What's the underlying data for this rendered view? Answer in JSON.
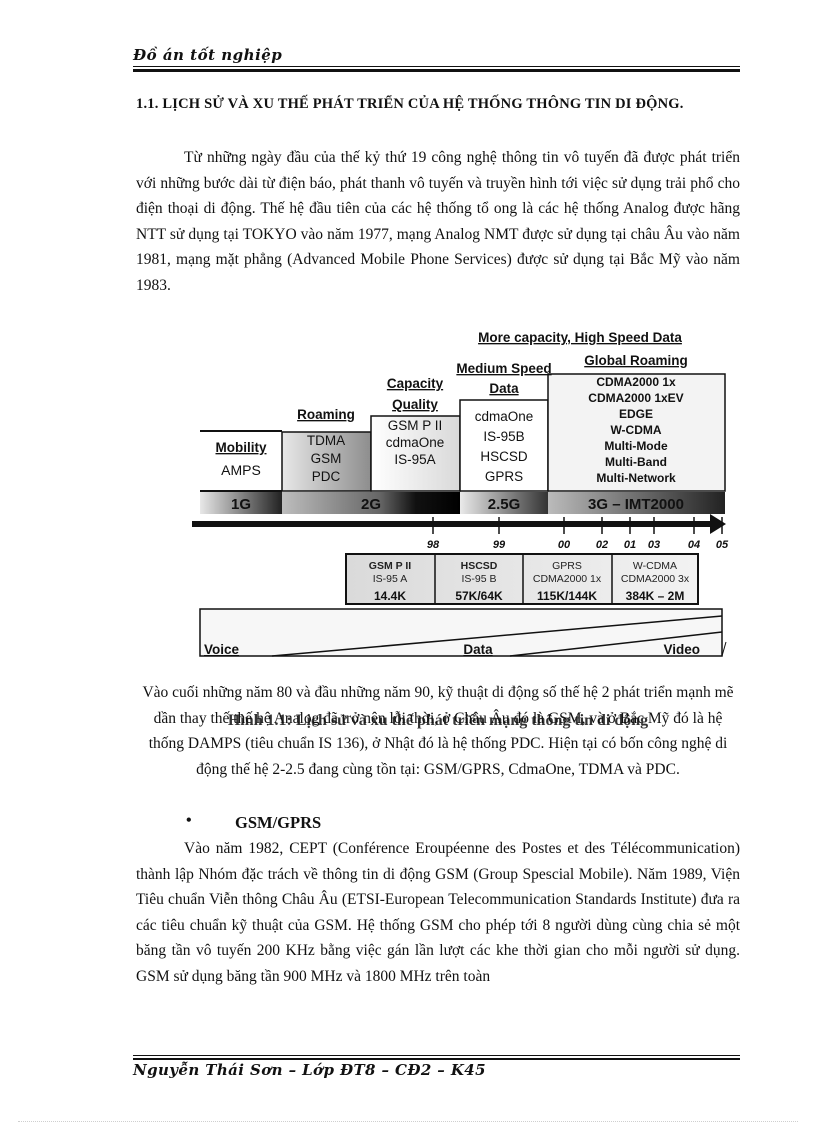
{
  "header": {
    "title": "Đồ án tốt nghiệp"
  },
  "section": {
    "title": "1.1. LỊCH SỬ VÀ XU THẾ PHÁT TRIỂN CỦA HỆ THỐNG THÔNG TIN DI ĐỘNG."
  },
  "paragraphs": {
    "intro": "Từ những ngày đầu của thế kỷ thứ 19 công nghệ thông tin vô tuyến đã được phát triển với những bước dài từ điện báo, phát thanh vô tuyến và truyền hình tới việc sử dụng trải phổ cho điện thoại di động. Thế hệ đầu tiên của các hệ thống tổ ong là các hệ thống Analog được hãng NTT sử dụng tại TOKYO vào năm 1977, mạng Analog NMT được sử dụng tại châu Âu vào năm 1981, mạng mặt phẳng (Advanced Mobile Phone Services) được sử dụng tại Bắc Mỹ vào năm 1983.",
    "second_gen": "Vào cuối những năm 80 và đầu những năm 90, kỹ thuật di động số thế hệ 2 phát triển mạnh mẽ dần thay thế thế hệ Analog đã trở nên lỗi thời, ở Châu Âu đó là GSM, và ở Bắc Mỹ đó là hệ thống DAMPS (tiêu chuẩn IS 136), ở Nhật đó là hệ thống PDC. Hiện tại có bốn công nghệ di động thế hệ 2-2.5 đang cùng tồn tại: GSM/GPRS, CdmaOne, TDMA và PDC.",
    "gsm": "Vào năm 1982, CEPT (Conférence Eroupéenne des Postes et des Télécommunication) thành lập Nhóm đặc trách về thông tin di động GSM (Group Spescial Mobile). Năm 1989, Viện Tiêu chuẩn Viễn thông Châu Âu (ETSI-European Telecommunication Standards Institute) đưa ra các tiêu chuẩn kỹ thuật của GSM. Hệ thống GSM cho phép tới 8 người dùng cùng chia sẻ một băng tần vô tuyến 200 KHz bằng việc gán lần lượt các khe thời gian cho mỗi người sử dụng. GSM sử dụng băng tần 900 MHz và 1800 MHz trên toàn"
  },
  "figure": {
    "caption": "Hình 1.1: Lịch sử và xu thế phát triển mạng thông tin di động",
    "top_label": "More capacity, High Speed Data",
    "steps": [
      {
        "heading": [
          "Mobility"
        ],
        "items": [
          "AMPS"
        ]
      },
      {
        "heading": [
          "Roaming"
        ],
        "items": [
          "TDMA",
          "GSM",
          "PDC"
        ]
      },
      {
        "heading": [
          "Capacity",
          "Quality"
        ],
        "items": [
          "GSM P II",
          "cdmaOne",
          "IS-95A"
        ]
      },
      {
        "heading": [
          "Medium Speed",
          "Data"
        ],
        "items": [
          "cdmaOne",
          "IS-95B",
          "HSCSD",
          "GPRS"
        ]
      },
      {
        "heading": [
          "Global Roaming"
        ],
        "items": [
          "CDMA2000 1x",
          "CDMA2000 1xEV",
          "EDGE",
          "W-CDMA",
          "Multi-Mode",
          "Multi-Band",
          "Multi-Network"
        ]
      }
    ],
    "generations": [
      "1G",
      "2G",
      "2.5G",
      "3G – IMT2000"
    ],
    "years": [
      "98",
      "99",
      "00",
      "01",
      "02",
      "03",
      "04",
      "05"
    ],
    "rates": [
      {
        "lines": [
          "GSM P II",
          "IS-95 A"
        ],
        "speed": "14.4K"
      },
      {
        "lines": [
          "HSCSD",
          "IS-95 B"
        ],
        "speed": "57K/64K"
      },
      {
        "lines": [
          "GPRS",
          "CDMA2000 1x"
        ],
        "speed": "115K/144K"
      },
      {
        "lines": [
          "W-CDMA",
          "CDMA2000 3x"
        ],
        "speed": "384K – 2M"
      }
    ],
    "traffic": [
      "Voice",
      "Data",
      "Video"
    ]
  },
  "bullet": {
    "symbol": "•",
    "label": "GSM/GPRS"
  },
  "footer": {
    "title": "Nguyễn Thái Sơn – Lớp ĐT8 – CĐ2 – K45"
  }
}
